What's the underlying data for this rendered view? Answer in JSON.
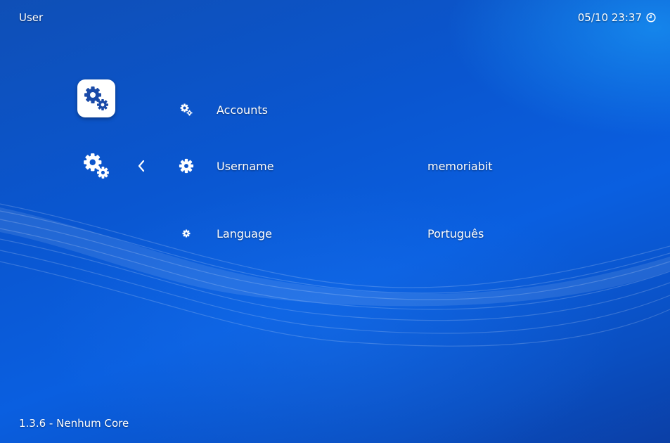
{
  "header": {
    "title": "User",
    "datetime": "05/10 23:37",
    "clock_icon": "clock-icon"
  },
  "category": {
    "selected_icon": "gears-icon",
    "back_icon": "chevron-left-icon"
  },
  "settings": [
    {
      "label": "Accounts",
      "value": "",
      "icon": "gears-icon"
    },
    {
      "label": "Username",
      "value": "memoriabit",
      "icon": "gear-icon"
    },
    {
      "label": "Language",
      "value": "Português",
      "icon": "small-gear-icon"
    }
  ],
  "footer": {
    "version": "1.3.6 - Nenhum Core"
  },
  "colors": {
    "background": "#0a56d0",
    "tile": "#ffffff",
    "icon_dark": "#1a4aa8",
    "text": "#ffffff"
  }
}
